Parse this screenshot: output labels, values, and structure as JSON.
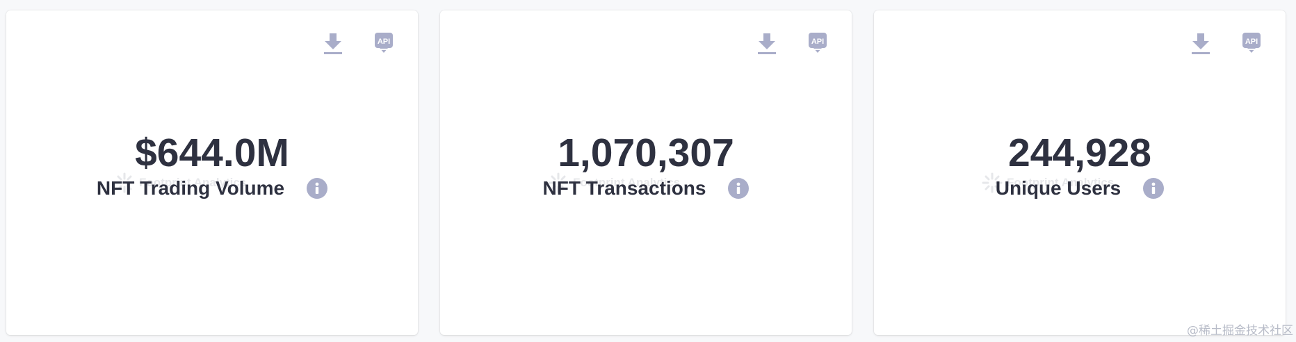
{
  "colors": {
    "value_text": "#2e3140",
    "icon": "#a9adc9",
    "card_bg": "#ffffff",
    "page_bg": "#f7f8fa"
  },
  "icons": {
    "download": "download-icon",
    "api": "api-icon",
    "info": "info-icon",
    "watermark_logo": "footprint-logo-icon"
  },
  "cards": [
    {
      "value": "$644.0M",
      "label": "NFT Trading Volume",
      "api_text": "API",
      "watermark": "Footprint Analytics"
    },
    {
      "value": "1,070,307",
      "label": "NFT Transactions",
      "api_text": "API",
      "watermark": "Footprint Analytics"
    },
    {
      "value": "244,928",
      "label": "Unique Users",
      "api_text": "API",
      "watermark": "Footprint Analytics"
    }
  ],
  "site_watermark": "@稀土掘金技术社区"
}
